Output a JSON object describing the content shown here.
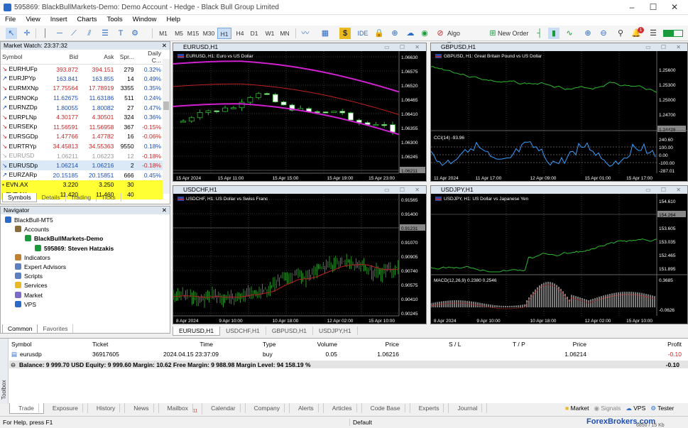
{
  "window": {
    "title": "595869: BlackBullMarkets-Demo: Demo Account - Hedge - Black Bull Group Limited"
  },
  "menu": [
    "File",
    "View",
    "Insert",
    "Charts",
    "Tools",
    "Window",
    "Help"
  ],
  "toolbar": {
    "timeframes": [
      "M1",
      "M5",
      "M15",
      "M30",
      "H1",
      "H4",
      "D1",
      "W1",
      "MN"
    ],
    "active_timeframe": "H1",
    "ide": "IDE",
    "algo_trading": "Algo Trading",
    "new_order": "New Order",
    "notifications": "1"
  },
  "market_watch": {
    "title": "Market Watch: 23:37:32",
    "columns": [
      "Symbol",
      "Bid",
      "Ask",
      "Spr...",
      "Daily C..."
    ],
    "rows": [
      {
        "symbol": "EURHUFp",
        "bid": "393.872",
        "ask": "394.151",
        "spread": "279",
        "change": "0.32%",
        "dir": "down"
      },
      {
        "symbol": "EURJPYp",
        "bid": "163.841",
        "ask": "163.855",
        "spread": "14",
        "change": "0.49%",
        "dir": "up"
      },
      {
        "symbol": "EURMXNp",
        "bid": "17.75564",
        "ask": "17.78919",
        "spread": "3355",
        "change": "0.35%",
        "dir": "down"
      },
      {
        "symbol": "EURNOKp",
        "bid": "11.62675",
        "ask": "11.63186",
        "spread": "511",
        "change": "0.24%",
        "dir": "up"
      },
      {
        "symbol": "EURNZDp",
        "bid": "1.80055",
        "ask": "1.80082",
        "spread": "27",
        "change": "0.47%",
        "dir": "up"
      },
      {
        "symbol": "EURPLNp",
        "bid": "4.30177",
        "ask": "4.30501",
        "spread": "324",
        "change": "0.36%",
        "dir": "down"
      },
      {
        "symbol": "EURSEKp",
        "bid": "11.56591",
        "ask": "11.56958",
        "spread": "367",
        "change": "-0.15%",
        "dir": "down"
      },
      {
        "symbol": "EURSGDp",
        "bid": "1.47766",
        "ask": "1.47782",
        "spread": "16",
        "change": "-0.06%",
        "dir": "down"
      },
      {
        "symbol": "EURTRYp",
        "bid": "34.45813",
        "ask": "34.55363",
        "spread": "9550",
        "change": "0.18%",
        "dir": "down"
      },
      {
        "symbol": "EURUSD",
        "bid": "1.06211",
        "ask": "1.06223",
        "spread": "12",
        "change": "-0.18%",
        "dir": "grey"
      },
      {
        "symbol": "EURUSDp",
        "bid": "1.06214",
        "ask": "1.06216",
        "spread": "2",
        "change": "-0.18%",
        "dir": "sel"
      },
      {
        "symbol": "EURZARp",
        "bid": "20.15185",
        "ask": "20.15851",
        "spread": "666",
        "change": "0.45%",
        "dir": "up"
      },
      {
        "symbol": "EVN.AX",
        "bid": "3.220",
        "ask": "3.250",
        "spread": "30",
        "change": "",
        "dir": "yellow"
      },
      {
        "symbol": "EVT.AX",
        "bid": "11.420",
        "ask": "11.460",
        "spread": "40",
        "change": "",
        "dir": "yellow"
      }
    ],
    "tabs": [
      "Symbols",
      "Details",
      "Trading",
      "Ticks"
    ]
  },
  "navigator": {
    "title": "Navigator",
    "items": [
      {
        "label": "BlackBull-MT5",
        "level": 0,
        "bold": false
      },
      {
        "label": "Accounts",
        "level": 1,
        "bold": false
      },
      {
        "label": "BlackBullMarkets-Demo",
        "level": 2,
        "bold": true
      },
      {
        "label": "595869: Steven Hatzakis",
        "level": 3,
        "bold": true
      },
      {
        "label": "Indicators",
        "level": 1,
        "bold": false
      },
      {
        "label": "Expert Advisors",
        "level": 1,
        "bold": false
      },
      {
        "label": "Scripts",
        "level": 1,
        "bold": false
      },
      {
        "label": "Services",
        "level": 1,
        "bold": false
      },
      {
        "label": "Market",
        "level": 1,
        "bold": false
      },
      {
        "label": "VPS",
        "level": 1,
        "bold": false
      }
    ],
    "tabs": [
      "Common",
      "Favorites"
    ]
  },
  "charts": [
    {
      "tab": "EURUSD,H1",
      "label": "EURUSD, H1:  Euro vs US Dollar",
      "prices": [
        "1.06630",
        "1.06575",
        "1.06520",
        "1.06465",
        "1.06410",
        "1.06355",
        "1.06300",
        "1.06245",
        "1.06211"
      ],
      "times": [
        "15 Apr 2024",
        "15 Apr 11:00",
        "15 Apr 15:00",
        "15 Apr 19:00",
        "15 Apr 23:00"
      ]
    },
    {
      "tab": "GBPUSD,H1",
      "label": "GBPUSD, H1:  Great Britain Pound vs US Dollar",
      "prices": [
        "1.25600",
        "1.25300",
        "1.25000",
        "1.24700",
        "1.24428"
      ],
      "indicator": "CCI(14) -93.96",
      "ind_levels": [
        "240.60",
        "100.00",
        "0.00",
        "-100.00",
        "-287.01"
      ],
      "times": [
        "11 Apr 2024",
        "11 Apr 17:00",
        "12 Apr 09:00",
        "15 Apr 01:00",
        "15 Apr 17:00"
      ]
    },
    {
      "tab": "USDCHF,H1",
      "label": "USDCHF, H1:  US Dollar vs Swiss Franc",
      "prices": [
        "0.91565",
        "0.91400",
        "0.91231",
        "0.91070",
        "0.90905",
        "0.90740",
        "0.90575",
        "0.90410",
        "0.90245"
      ],
      "times": [
        "8 Apr 2024",
        "9 Apr 10:00",
        "10 Apr 18:00",
        "12 Apr 02:00",
        "15 Apr 10:00"
      ]
    },
    {
      "tab": "USDJPY,H1",
      "label": "USDJPY, H1:  US Dollar vs Japanese Yen",
      "prices": [
        "154.610",
        "154.264",
        "153.605",
        "153.035",
        "152.465",
        "151.895"
      ],
      "indicator": "MACD(12,26,9) 0.2380 0.2546",
      "ind_levels": [
        "0.3685",
        "-0.0626"
      ],
      "times": [
        "8 Apr 2024",
        "9 Apr 10:00",
        "10 Apr 18:00",
        "12 Apr 02:00",
        "15 Apr 10:00"
      ]
    }
  ],
  "trade": {
    "columns": [
      "Symbol",
      "Ticket",
      "Time",
      "Type",
      "Volume",
      "Price",
      "S / L",
      "T / P",
      "Price",
      "Profit"
    ],
    "rows": [
      {
        "symbol": "eurusdp",
        "ticket": "36917605",
        "time": "2024.04.15 23:37:09",
        "type": "buy",
        "volume": "0.05",
        "price": "1.06216",
        "sl": "",
        "tp": "",
        "cur": "1.06214",
        "profit": "-0.10"
      }
    ],
    "balance": "Balance: 9 999.70 USD  Equity: 9 999.60  Margin: 10.62  Free Margin: 9 988.98  Margin Level: 94 158.19 %",
    "total": "-0.10"
  },
  "toolbox": {
    "label": "Toolbox",
    "tabs": [
      "Trade",
      "Exposure",
      "History",
      "News",
      "Mailbox",
      "Calendar",
      "Company",
      "Alerts",
      "Articles",
      "Code Base",
      "Experts",
      "Journal"
    ],
    "mailbox_count": "11",
    "right": [
      "Market",
      "Signals",
      "VPS",
      "Tester"
    ]
  },
  "status": {
    "help": "For Help, press F1",
    "profile": "Default",
    "traffic": "6850 / 15 Kb",
    "watermark": "ForexBrokers.com"
  }
}
